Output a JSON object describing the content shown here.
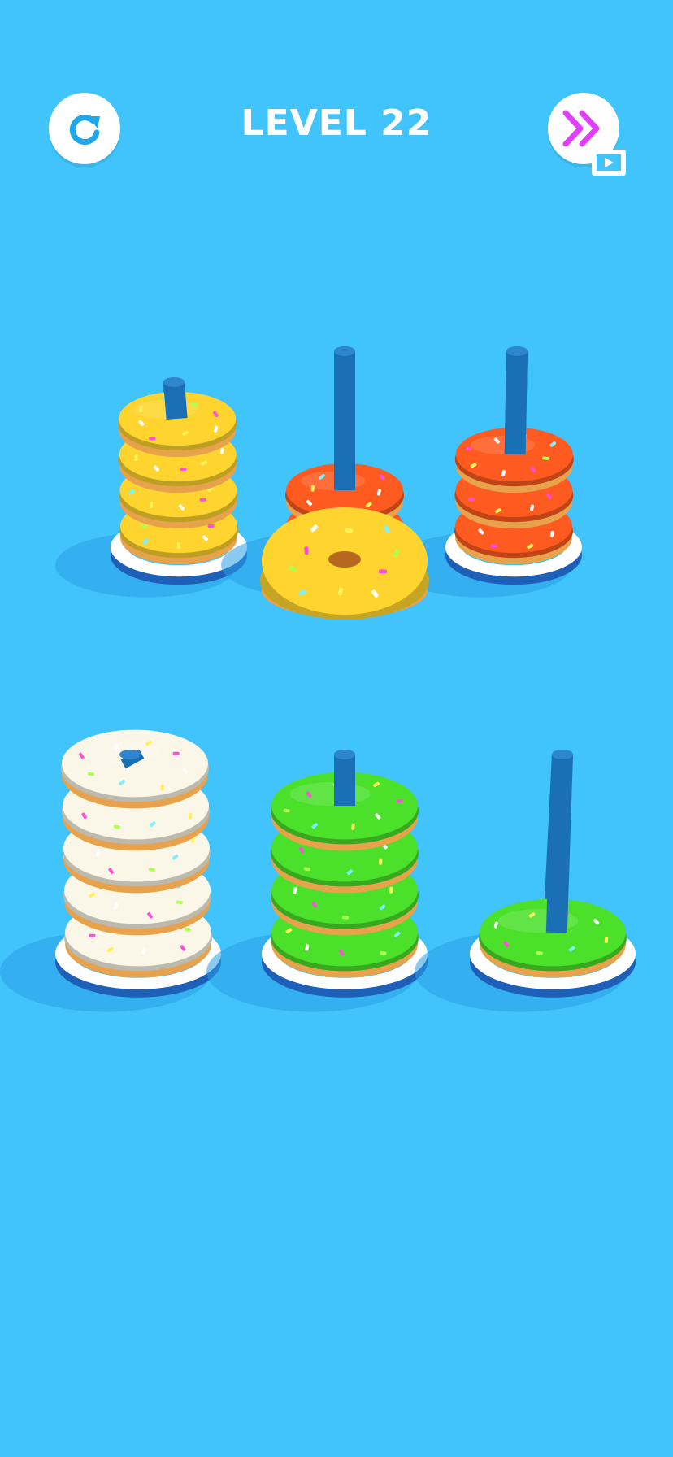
{
  "header": {
    "level_label": "LEVEL 22",
    "restart_icon": "restart-icon",
    "skip_icon": "double-chevron-right-icon",
    "skip_badge_icon": "video-ad-icon"
  },
  "colors": {
    "background": "#41c4fc",
    "hud_button": "#ffffff",
    "skip_accent": "#e040fb",
    "restart_accent": "#1fa7e8",
    "peg": "#1b6fb5",
    "yellow": "#ffd42e",
    "orange": "#ff5a1f",
    "white": "#fbf7e8",
    "green": "#4be02a"
  },
  "stacks": [
    {
      "name": "stack-1",
      "rings": [
        "yellow",
        "yellow",
        "yellow",
        "yellow"
      ]
    },
    {
      "name": "stack-2",
      "rings": [
        "orange",
        "orange"
      ]
    },
    {
      "name": "stack-3",
      "rings": [
        "orange",
        "orange",
        "orange"
      ]
    },
    {
      "name": "stack-4",
      "rings": [
        "white",
        "white",
        "white",
        "white",
        "white"
      ]
    },
    {
      "name": "stack-5",
      "rings": [
        "green",
        "green",
        "green",
        "green"
      ]
    },
    {
      "name": "stack-6",
      "rings": [
        "green"
      ]
    }
  ],
  "lifted_ring": {
    "color": "yellow",
    "over_stack": "stack-2"
  }
}
